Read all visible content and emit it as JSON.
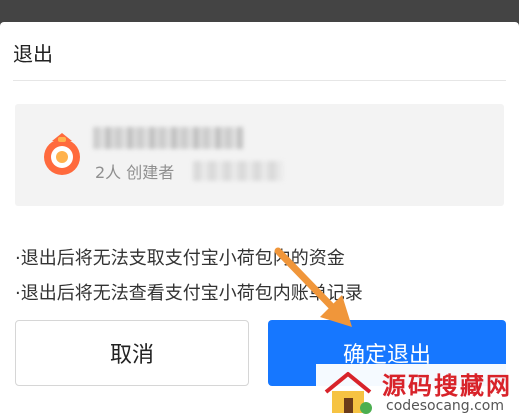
{
  "dialog": {
    "title": "退出",
    "card": {
      "icon": "wallet-pouch-icon",
      "subtitle": "2人 创建者"
    },
    "notes": [
      "·退出后将无法支取支付宝小荷包内的资金",
      "·退出后将无法查看支付宝小荷包内账单记录"
    ],
    "buttons": {
      "cancel": "取消",
      "confirm": "确定退出"
    }
  },
  "watermark": {
    "title": "源码搜藏网",
    "url": "codesocang.com"
  },
  "colors": {
    "accent": "#1677ff",
    "icon_orange": "#ff6a3d",
    "arrow": "#f0963a",
    "watermark_red": "#d8232a"
  }
}
